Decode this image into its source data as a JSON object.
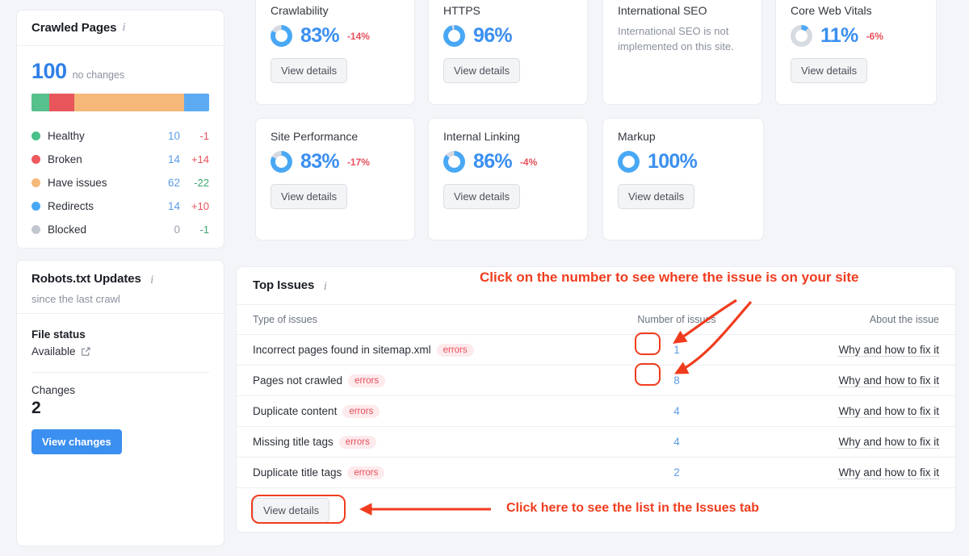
{
  "crawled_pages": {
    "title": "Crawled Pages",
    "info_icon": "info-icon",
    "total": "100",
    "total_note": "no changes",
    "segments": [
      {
        "name": "Healthy",
        "color": "#57c18d",
        "percent": 10
      },
      {
        "name": "Broken",
        "color": "#e8565c",
        "percent": 14
      },
      {
        "name": "Have issues",
        "color": "#f5b878",
        "percent": 62
      },
      {
        "name": "Redirects",
        "color": "#5cabf2",
        "percent": 14
      }
    ],
    "legend": [
      {
        "label": "Healthy",
        "value": "10",
        "delta": "-1",
        "delta_dir": "down",
        "color": "#48c08a",
        "muted": false
      },
      {
        "label": "Broken",
        "value": "14",
        "delta": "+14",
        "delta_dir": "up",
        "color": "#ee5a5f",
        "muted": false
      },
      {
        "label": "Have issues",
        "value": "62",
        "delta": "-22",
        "delta_dir": "good",
        "color": "#f5b878",
        "muted": false
      },
      {
        "label": "Redirects",
        "value": "14",
        "delta": "+10",
        "delta_dir": "up",
        "color": "#49a8f5",
        "muted": false
      },
      {
        "label": "Blocked",
        "value": "0",
        "delta": "-1",
        "delta_dir": "good",
        "color": "#c3c8d0",
        "muted": true
      }
    ]
  },
  "robots": {
    "title": "Robots.txt Updates",
    "subtitle": "since the last crawl",
    "file_status_label": "File status",
    "file_status_value": "Available",
    "external_icon": "external-link-icon",
    "changes_label": "Changes",
    "changes_value": "2",
    "button": "View changes"
  },
  "metrics": [
    {
      "title": "Crawlability",
      "percent": "83%",
      "value": 83,
      "delta": "-14%",
      "button": "View details",
      "note": null
    },
    {
      "title": "HTTPS",
      "percent": "96%",
      "value": 96,
      "delta": null,
      "button": "View details",
      "note": null
    },
    {
      "title": "International SEO",
      "percent": null,
      "value": null,
      "delta": null,
      "button": null,
      "note": "International SEO is not implemented on this site."
    },
    {
      "title": "Core Web Vitals",
      "percent": "11%",
      "value": 11,
      "delta": "-6%",
      "button": "View details",
      "note": null
    },
    {
      "title": "Site Performance",
      "percent": "83%",
      "value": 83,
      "delta": "-17%",
      "button": "View details",
      "note": null
    },
    {
      "title": "Internal Linking",
      "percent": "86%",
      "value": 86,
      "delta": "-4%",
      "button": "View details",
      "note": null
    },
    {
      "title": "Markup",
      "percent": "100%",
      "value": 100,
      "delta": null,
      "button": "View details",
      "note": null
    }
  ],
  "top_issues": {
    "title": "Top Issues",
    "info_icon": "info-icon",
    "columns": [
      "Type of issues",
      "Number of issues",
      "About the issue"
    ],
    "rows": [
      {
        "type": "Incorrect pages found in sitemap.xml",
        "severity": "errors",
        "count": "1",
        "link": "Why and how to fix it",
        "highlighted": true
      },
      {
        "type": "Pages not crawled",
        "severity": "errors",
        "count": "8",
        "link": "Why and how to fix it",
        "highlighted": true
      },
      {
        "type": "Duplicate content",
        "severity": "errors",
        "count": "4",
        "link": "Why and how to fix it",
        "highlighted": false
      },
      {
        "type": "Missing title tags",
        "severity": "errors",
        "count": "4",
        "link": "Why and how to fix it",
        "highlighted": false
      },
      {
        "type": "Duplicate title tags",
        "severity": "errors",
        "count": "2",
        "link": "Why and how to fix it",
        "highlighted": false
      }
    ],
    "footer_button": "View details"
  },
  "annotations": {
    "color": "#f03c1e",
    "numbers_hint": "Click on the number to see where the issue is on your site",
    "view_details_hint": "Click here to see the list in the Issues tab"
  }
}
